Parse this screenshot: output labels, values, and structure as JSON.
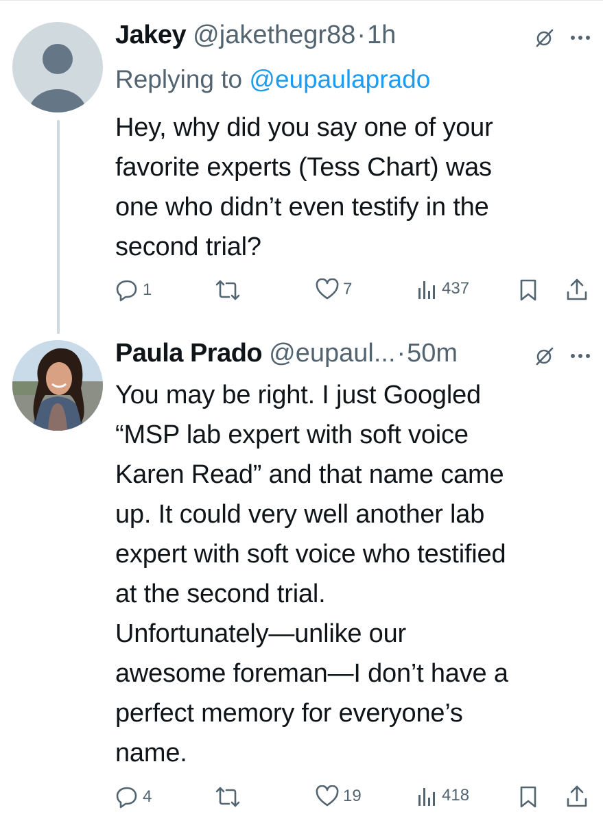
{
  "tweets": [
    {
      "name": "Jakey",
      "handle": "@jakethegr88",
      "separator": "·",
      "time": "1h",
      "replying_prefix": "Replying to ",
      "replying_handle": "@eupaulaprado",
      "text_lines": [
        "Hey, why did you say one of your",
        "favorite experts (Tess Chart) was",
        "one who didn’t even testify in the",
        "second trial?"
      ],
      "replies": "1",
      "retweets": "",
      "likes": "7",
      "views": "437"
    },
    {
      "name": "Paula Prado",
      "handle": "@eupaul...",
      "separator": "·",
      "time": "50m",
      "text_lines": [
        "You may be right. I just Googled",
        "“MSP lab expert with soft voice",
        "Karen Read” and that name came",
        "up. It could very well another lab",
        "expert with soft voice who testified",
        "at the second trial.",
        "Unfortunately—unlike our",
        "awesome foreman—I don’t have a",
        "perfect memory for everyone’s",
        "name."
      ],
      "replies": "4",
      "retweets": "",
      "likes": "19",
      "views": "418"
    }
  ],
  "colors": {
    "text": "#0f1419",
    "secondary": "#536471",
    "link": "#1d9bf0",
    "thread_line": "#cfd9de"
  },
  "icons": [
    "grok-icon",
    "more-icon",
    "reply-icon",
    "retweet-icon",
    "like-icon",
    "views-icon",
    "bookmark-icon",
    "share-icon"
  ]
}
